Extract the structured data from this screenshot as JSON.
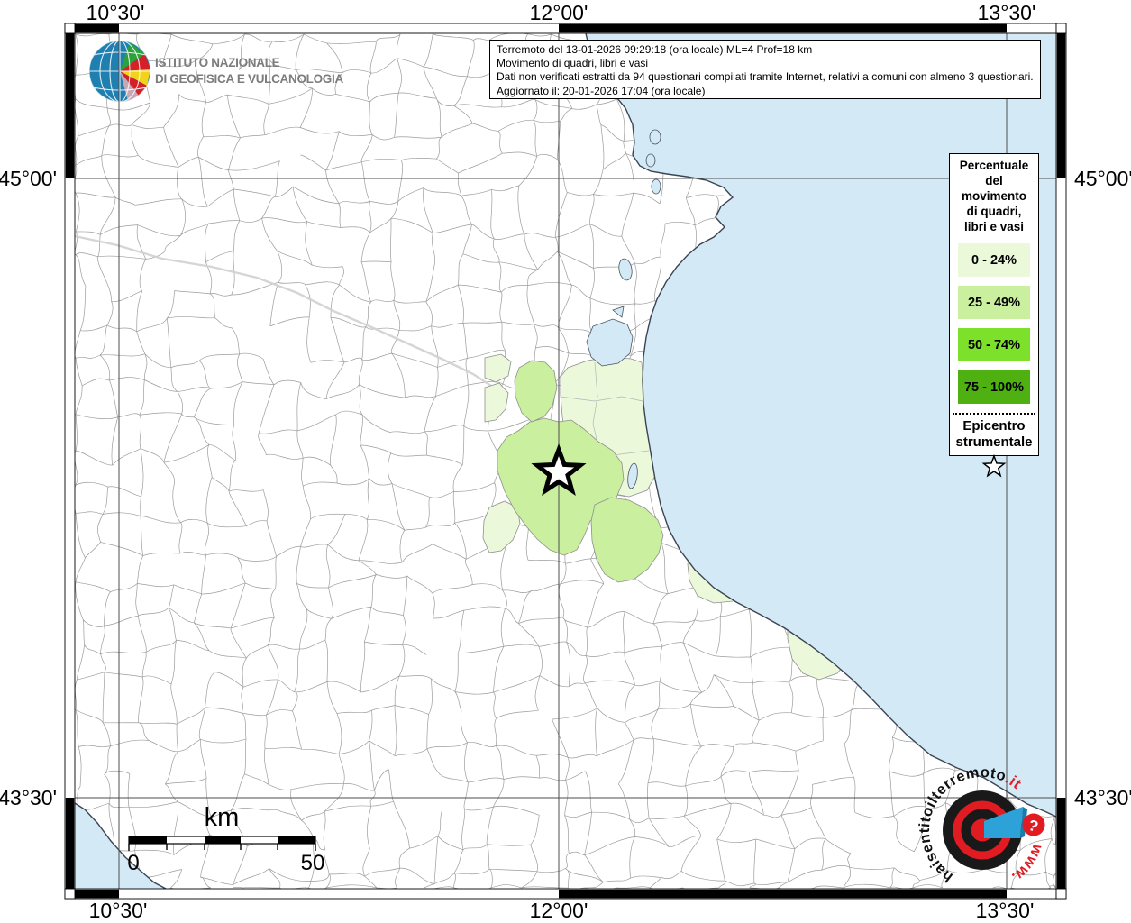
{
  "branding": {
    "institute_line1": "ISTITUTO NAZIONALE",
    "institute_line2": "DI GEOFISICA E VULCANOLOGIA"
  },
  "info_box": {
    "lines": [
      "Terremoto del 13-01-2026 09:29:18 (ora locale) ML=4 Prof=18 km",
      "Movimento di quadri, libri e vasi",
      "Dati non verificati estratti da 94 questionari compilati tramite Internet, relativi a comuni con almeno 3 questionari.",
      "Aggiornato il: 20-01-2026 17:04 (ora locale)"
    ]
  },
  "legend": {
    "title_lines": [
      "Percentuale",
      "del",
      "movimento",
      "di quadri,",
      "libri e vasi"
    ],
    "classes": [
      {
        "label": "0 - 24%",
        "color": "#ebf8da"
      },
      {
        "label": "25 - 49%",
        "color": "#c9ef9f"
      },
      {
        "label": "50 - 74%",
        "color": "#7de02b"
      },
      {
        "label": "75 - 100%",
        "color": "#4fb012"
      }
    ],
    "epicenter_line1": "Epicentro",
    "epicenter_line2": "strumentale"
  },
  "axis_labels": {
    "top": [
      "10°30'",
      "12°00'",
      "13°30'"
    ],
    "bottom": [
      "10°30'",
      "12°00'",
      "13°30'"
    ],
    "left": [
      "45°00'",
      "43°30'"
    ],
    "right": [
      "45°00'",
      "43°30'"
    ]
  },
  "scale_bar": {
    "unit_label": "km",
    "start_label": "0",
    "end_label": "50"
  },
  "watermark": {
    "site_black": "haisentitoilterremoto",
    "site_it": ".it",
    "site_www": "www.",
    "badge": "?"
  },
  "colors": {
    "sea": "#d3e9f6",
    "c0_24": "#ebf8da",
    "c25_49": "#c9ef9f",
    "c50_74": "#7de02b",
    "c75_100": "#4fb012",
    "logo_red": "#e01b22",
    "logo_blue": "#2da2d8"
  }
}
